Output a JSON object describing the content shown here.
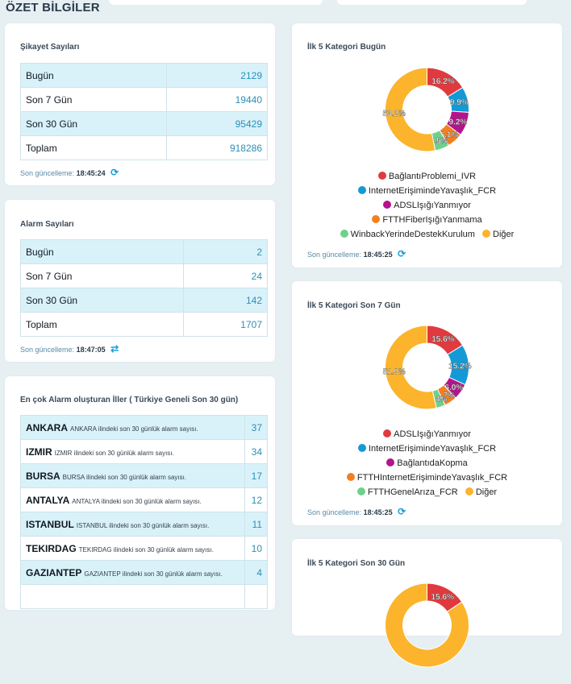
{
  "section_title": "ÖZET BİLGİLER",
  "update_prefix": "Son güncelleme:",
  "complaints": {
    "title": "Şikayet Sayıları",
    "rows": [
      {
        "label": "Bugün",
        "value": "2129"
      },
      {
        "label": "Son 7 Gün",
        "value": "19440"
      },
      {
        "label": "Son 30 Gün",
        "value": "95429"
      },
      {
        "label": "Toplam",
        "value": "918286"
      }
    ],
    "updated": "18:45:24"
  },
  "alarms": {
    "title": "Alarm Sayıları",
    "rows": [
      {
        "label": "Bugün",
        "value": "2"
      },
      {
        "label": "Son 7 Gün",
        "value": "24"
      },
      {
        "label": "Son 30 Gün",
        "value": "142"
      },
      {
        "label": "Toplam",
        "value": "1707"
      }
    ],
    "updated": "18:47:05"
  },
  "provinces": {
    "title": "En çok Alarm oluşturan İller ( Türkiye Geneli Son 30 gün)",
    "rows": [
      {
        "name": "ANKARA",
        "desc": "ANKARA ilindeki son 30 günlük alarm sayısı.",
        "value": "37"
      },
      {
        "name": "IZMIR",
        "desc": "IZMIR ilindeki son 30 günlük alarm sayısı.",
        "value": "34"
      },
      {
        "name": "BURSA",
        "desc": "BURSA ilindeki son 30 günlük alarm sayısı.",
        "value": "17"
      },
      {
        "name": "ANTALYA",
        "desc": "ANTALYA ilindeki son 30 günlük alarm sayısı.",
        "value": "12"
      },
      {
        "name": "ISTANBUL",
        "desc": "ISTANBUL ilindeki son 30 günlük alarm sayısı.",
        "value": "11"
      },
      {
        "name": "TEKIRDAG",
        "desc": "TEKIRDAG ilindeki son 30 günlük alarm sayısı.",
        "value": "10"
      },
      {
        "name": "GAZIANTEP",
        "desc": "GAZIANTEP ilindeki son 30 günlük alarm sayısı.",
        "value": "4"
      }
    ]
  },
  "colors": {
    "red": "#e03a3e",
    "blue": "#139ad6",
    "purple": "#b5138c",
    "orange": "#f47f20",
    "green": "#6fd08c",
    "yellow": "#fbb42c"
  },
  "chart_data": [
    {
      "type": "pie",
      "title": "İlk 5 Kategori Bugün",
      "slices": [
        {
          "name": "BağlantıProblemi_IVR",
          "value": 16.2,
          "label": "16.2%",
          "color": "#e03a3e"
        },
        {
          "name": "InternetErişimindeYavaşlık_FCR",
          "value": 9.9,
          "label": "9.9%",
          "color": "#139ad6"
        },
        {
          "name": "ADSLIşığıYanmıyor",
          "value": 9.2,
          "label": "9.2%",
          "color": "#b5138c"
        },
        {
          "name": "FTTHFiberIşığıYanmama",
          "value": 6.1,
          "label": "6.1%",
          "color": "#f47f20"
        },
        {
          "name": "WinbackYerindeDestekKurulum",
          "value": 5.5,
          "label": "5.5%",
          "color": "#6fd08c"
        },
        {
          "name": "Diğer",
          "value": 53.2,
          "label": "53.2%",
          "color": "#fbb42c"
        }
      ],
      "updated": "18:45:25"
    },
    {
      "type": "pie",
      "title": "İlk 5 Kategori Son 7 Gün",
      "slices": [
        {
          "name": "ADSLIşığıYanmıyor",
          "value": 15.6,
          "label": "15.6%",
          "color": "#e03a3e"
        },
        {
          "name": "InternetErişimindeYavaşlık_FCR",
          "value": 15.2,
          "label": "15.2%",
          "color": "#139ad6"
        },
        {
          "name": "BağlantıdaKopma",
          "value": 6.0,
          "label": "6.0%",
          "color": "#b5138c"
        },
        {
          "name": "FTTHInternetErişimindeYavaşlık_FCR",
          "value": 4.7,
          "label": "4.7%",
          "color": "#f47f20"
        },
        {
          "name": "FTTHGenelArıza_FCR",
          "value": 3.4,
          "label": "3.4%",
          "color": "#6fd08c"
        },
        {
          "name": "Diğer",
          "value": 51.9,
          "label": "51.9%",
          "color": "#fbb42c"
        }
      ],
      "updated": "18:45:25"
    },
    {
      "type": "pie",
      "title": "İlk 5 Kategori Son 30 Gün",
      "slices": [
        {
          "name": "",
          "value": 15.6,
          "label": "15.6%",
          "color": "#e03a3e"
        },
        {
          "name": "",
          "value": 84.4,
          "label": "",
          "color": "#fbb42c"
        }
      ]
    }
  ]
}
